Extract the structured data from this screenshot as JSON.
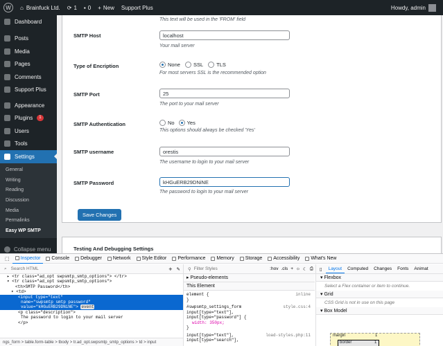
{
  "adminbar": {
    "site": "Brainfuck Ltd.",
    "updates": "1",
    "comments": "0",
    "new_label": "New",
    "plugin_label": "Support Plus",
    "howdy": "Howdy, admin"
  },
  "sidebar": {
    "items": [
      {
        "label": "Dashboard",
        "icon": "dashboard-icon"
      },
      {
        "label": "Posts",
        "icon": "pin-icon"
      },
      {
        "label": "Media",
        "icon": "media-icon"
      },
      {
        "label": "Pages",
        "icon": "page-icon"
      },
      {
        "label": "Comments",
        "icon": "comment-icon"
      },
      {
        "label": "Support Plus",
        "icon": "support-icon"
      },
      {
        "label": "Appearance",
        "icon": "brush-icon"
      },
      {
        "label": "Plugins",
        "icon": "plugin-icon",
        "badge": "1"
      },
      {
        "label": "Users",
        "icon": "users-icon"
      },
      {
        "label": "Tools",
        "icon": "wrench-icon"
      },
      {
        "label": "Settings",
        "icon": "settings-icon"
      }
    ],
    "submenu": [
      "General",
      "Writing",
      "Reading",
      "Discussion",
      "Media",
      "Permalinks",
      "Easy WP SMTP"
    ],
    "collapse": "Collapse menu"
  },
  "form": {
    "from_desc": "This text will be used in the 'FROM' field",
    "host_label": "SMTP Host",
    "host_value": "localhost",
    "host_desc": "Your mail server",
    "enc_label": "Type of Encription",
    "enc_options": [
      "None",
      "SSL",
      "TLS"
    ],
    "enc_selected": "None",
    "enc_desc": "For most servers SSL is the recommended option",
    "port_label": "SMTP Port",
    "port_value": "25",
    "port_desc": "The port to your mail server",
    "auth_label": "SMTP Authentication",
    "auth_options": [
      "No",
      "Yes"
    ],
    "auth_selected": "Yes",
    "auth_desc": "This options should always be checked 'Yes'",
    "user_label": "SMTP username",
    "user_value": "orestis",
    "user_desc": "The username to login to your mail server",
    "pass_label": "SMTP Password",
    "pass_value": "kHGuERB29DNiNE",
    "pass_desc": "The password to login to your mail server",
    "save_label": "Save Changes",
    "testing_heading": "Testing And Debugging Settings"
  },
  "devtools": {
    "tabs": [
      "Inspector",
      "Console",
      "Debugger",
      "Network",
      "Style Editor",
      "Performance",
      "Memory",
      "Storage",
      "Accessibility",
      "What's New"
    ],
    "search_placeholder": "Search HTML",
    "filter_placeholder": "Filter Styles",
    "hov": ":hov",
    "cls": ".cls",
    "layout_tabs": [
      "Layout",
      "Computed",
      "Changes",
      "Fonts",
      "Animat"
    ],
    "html_lines": [
      "<tr class=\"ad_opt swpsmtp_smtp_options\"> </tr>",
      "<tr class=\"ad_opt swpsmtp_smtp_options\">",
      "<th>SMTP Password</th>",
      "<td>",
      "<input type=\"text\"",
      "name=\"swpsmtp smtp password\"",
      "value=\"kHGuERB29DNiNE\">",
      "event",
      "<p class=\"description\">",
      "The password to login to your mail server",
      "</p>"
    ],
    "breadcrumbs": "ngs_form > table.form-table > tbody > tr.ad_opt.swpsmtp_smtp_options > td > input",
    "rules": {
      "pseudo": "Pseudo-elements",
      "this_element": "This Element",
      "element_rule": "element {",
      "element_src": "inline",
      "rule1_selector": "#swpsmtp_settings_form",
      "rule1_selector2": "input[type=\"text\"],",
      "rule1_selector3": "input[type=\"password\"] {",
      "rule1_src": "style.css:4",
      "rule1_prop": "width: 350px;",
      "rule2_selector": "input[type=\"text\"],",
      "rule2_selector2": "input[type=\"search\"],",
      "rule2_src": "load-styles.php:11"
    },
    "layout": {
      "flexbox": "Flexbox",
      "flex_note": "Select a Flex container or item to continue.",
      "grid": "Grid",
      "grid_note": "CSS Grid is not in use on this page",
      "boxmodel": "Box Model",
      "margin": "margin",
      "border": "border",
      "margin_val": "1",
      "border_val": "1"
    }
  }
}
